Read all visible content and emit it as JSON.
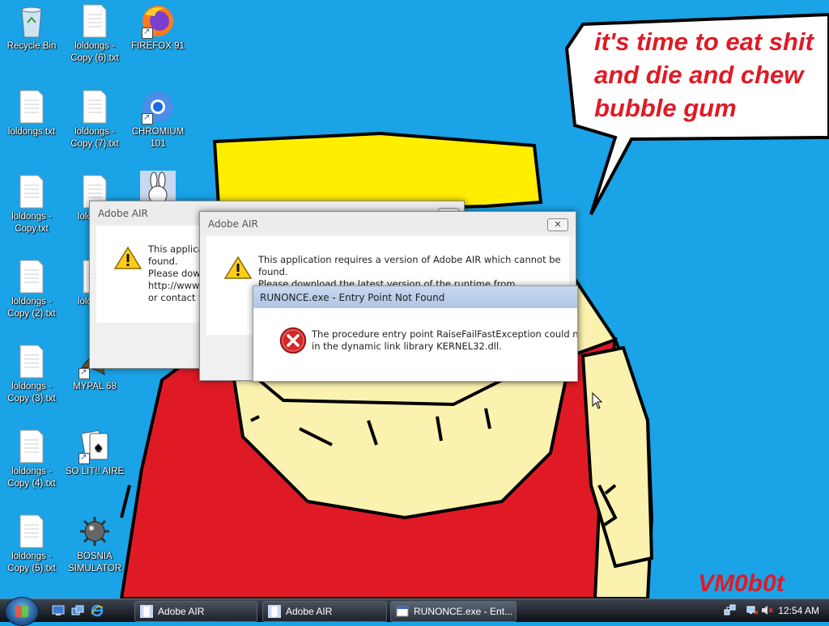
{
  "desktop": {
    "icons": [
      {
        "label": "Recycle Bin",
        "type": "recycle",
        "shortcut": false
      },
      {
        "label": "loldongs - Copy (6).txt",
        "type": "txt",
        "shortcut": false
      },
      {
        "label": "FIREFOX 91",
        "type": "firefox",
        "shortcut": true
      },
      {
        "label": "loldongs.txt",
        "type": "txt",
        "shortcut": false
      },
      {
        "label": "loldongs - Copy (7).txt",
        "type": "txt",
        "shortcut": false
      },
      {
        "label": "CHROMIUM 101",
        "type": "chromium",
        "shortcut": true
      },
      {
        "label": "loldongs - Copy.txt",
        "type": "txt",
        "shortcut": false
      },
      {
        "label": "lold Cop",
        "type": "txt",
        "shortcut": false
      },
      {
        "label": "",
        "type": "bunny",
        "shortcut": false
      },
      {
        "label": "loldongs - Copy (2).txt",
        "type": "txt",
        "shortcut": false
      },
      {
        "label": "lold Cop",
        "type": "txt",
        "shortcut": false
      },
      {
        "label": "loldongs - Copy (3).txt",
        "type": "txt",
        "shortcut": false
      },
      {
        "label": "MYPAL 68",
        "type": "mypal",
        "shortcut": true
      },
      {
        "label": "loldongs - Copy (4).txt",
        "type": "txt",
        "shortcut": false
      },
      {
        "label": "SO LIT!! AIRE",
        "type": "cards",
        "shortcut": true
      },
      {
        "label": "loldongs - Copy (5).txt",
        "type": "txt",
        "shortcut": false
      },
      {
        "label": "BOSNIA SIMULATOR",
        "type": "mine",
        "shortcut": false
      }
    ]
  },
  "wallpaper": {
    "speech_bubble": [
      "it's time to eat shit",
      "and die and chew",
      "bubble gum"
    ],
    "signature": "VM0b0t"
  },
  "dialogs": {
    "air_back": {
      "title": "Adobe AIR",
      "lines": [
        "This applicati",
        "found.",
        "Please down",
        "http://www.",
        "or contact th"
      ]
    },
    "air_front": {
      "title": "Adobe AIR",
      "close": "✕",
      "lines": [
        "This application requires a version of Adobe AIR which cannot be",
        "found.",
        "Please download the latest version of the runtime from"
      ]
    },
    "error": {
      "title": "RUNONCE.exe - Entry Point Not Found",
      "lines": [
        "The procedure entry point RaiseFailFastException could not be",
        "in the dynamic link library KERNEL32.dll."
      ]
    }
  },
  "taskbar": {
    "buttons": [
      {
        "label": "Adobe AIR"
      },
      {
        "label": "Adobe AIR"
      },
      {
        "label": "RUNONCE.exe - Ent..."
      }
    ],
    "clock": "12:54 AM"
  },
  "colors": {
    "desktop": "#1aa3e6",
    "hat": "#ffee00",
    "shirt": "#e01a25",
    "skin": "#fbf2b0",
    "bubble_text": "#e01a25",
    "signature": "#e01a25"
  }
}
